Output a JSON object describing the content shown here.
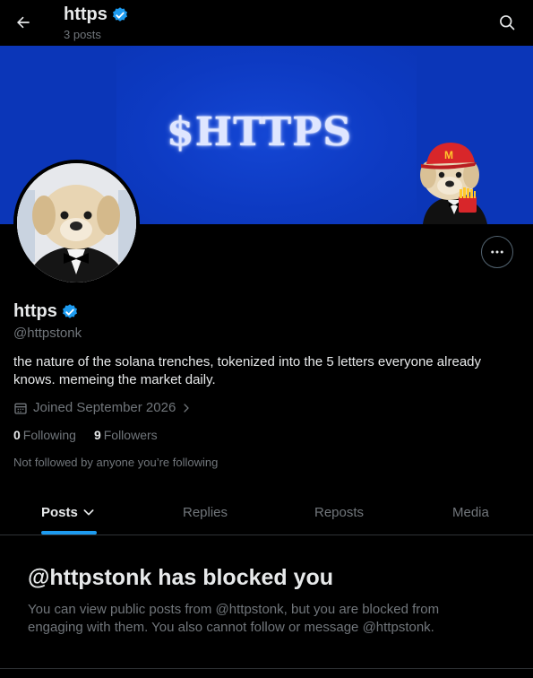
{
  "colors": {
    "background": "#000000",
    "text_primary": "#e7e9ea",
    "text_secondary": "#71767b",
    "accent": "#1d9bf0",
    "banner_blue": "#0b36b8"
  },
  "header": {
    "back_icon": "arrow-left-icon",
    "title": "https",
    "posts_count": "3 posts",
    "search_icon": "search-icon"
  },
  "banner": {
    "text": "$HTTPS"
  },
  "profile": {
    "name": "https",
    "verified_icon": "verified-badge-icon",
    "handle": "@httpstonk",
    "bio": "the nature of the solana trenches, tokenized into the 5 letters everyone already knows. memeing the market daily.",
    "joined": "Joined September 2026",
    "following_count": "0",
    "following_label": "Following",
    "followers_count": "9",
    "followers_label": "Followers",
    "not_followed": "Not followed by anyone you’re following"
  },
  "tabs": [
    {
      "label": "Posts",
      "active": true
    },
    {
      "label": "Replies",
      "active": false
    },
    {
      "label": "Reposts",
      "active": false
    },
    {
      "label": "Media",
      "active": false
    }
  ],
  "blocked": {
    "title": "@httpstonk has blocked you",
    "message": "You can view public posts from @httpstonk, but you are blocked from engaging with them. You also cannot follow or message @httpstonk."
  }
}
